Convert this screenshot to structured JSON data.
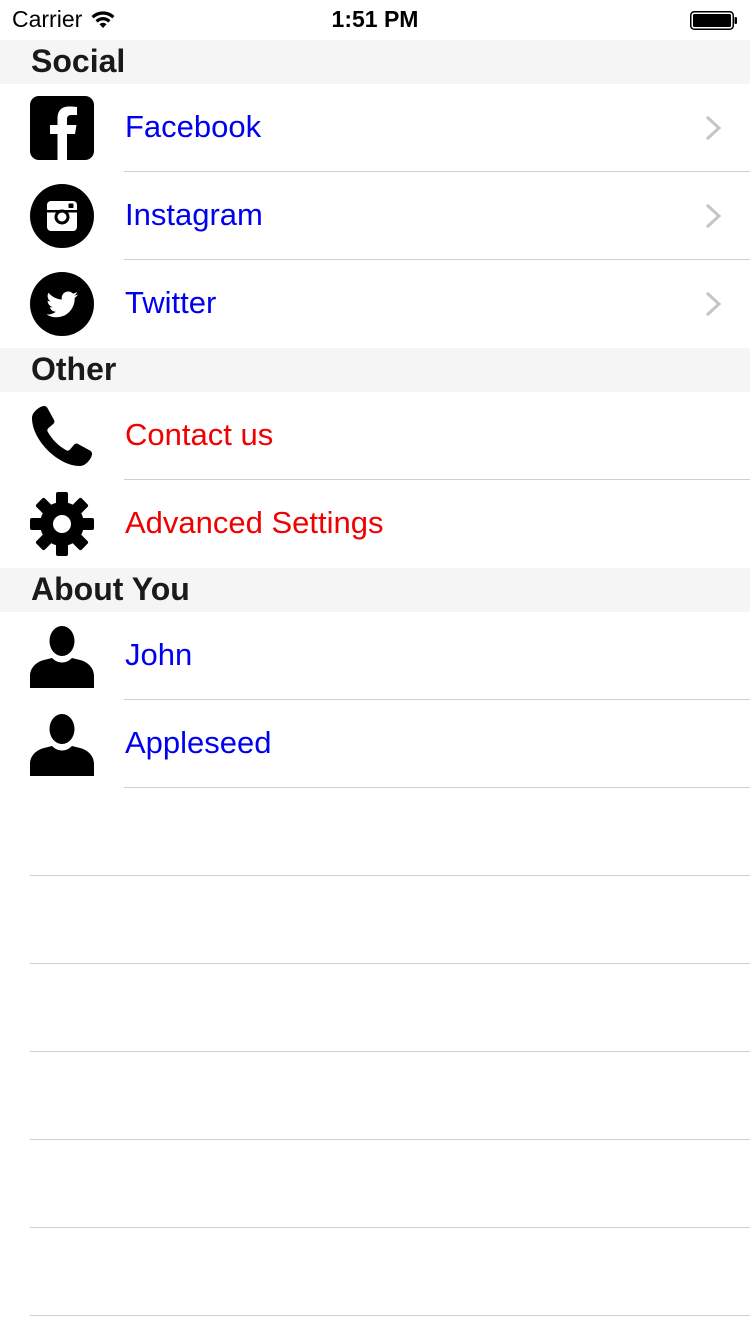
{
  "status_bar": {
    "carrier": "Carrier",
    "time": "1:51 PM"
  },
  "sections": {
    "social": {
      "title": "Social",
      "items": [
        {
          "label": "Facebook",
          "icon": "facebook-icon"
        },
        {
          "label": "Instagram",
          "icon": "instagram-icon"
        },
        {
          "label": "Twitter",
          "icon": "twitter-icon"
        }
      ]
    },
    "other": {
      "title": "Other",
      "items": [
        {
          "label": "Contact us",
          "icon": "phone-icon"
        },
        {
          "label": "Advanced Settings",
          "icon": "gear-icon"
        }
      ]
    },
    "about": {
      "title": "About You",
      "items": [
        {
          "label": "John",
          "icon": "person-icon"
        },
        {
          "label": "Appleseed",
          "icon": "person-icon"
        }
      ]
    }
  },
  "colors": {
    "link_blue": "#0000f0",
    "action_red": "#f00000",
    "header_bg": "#f5f5f5",
    "separator": "#cfcfcf"
  }
}
